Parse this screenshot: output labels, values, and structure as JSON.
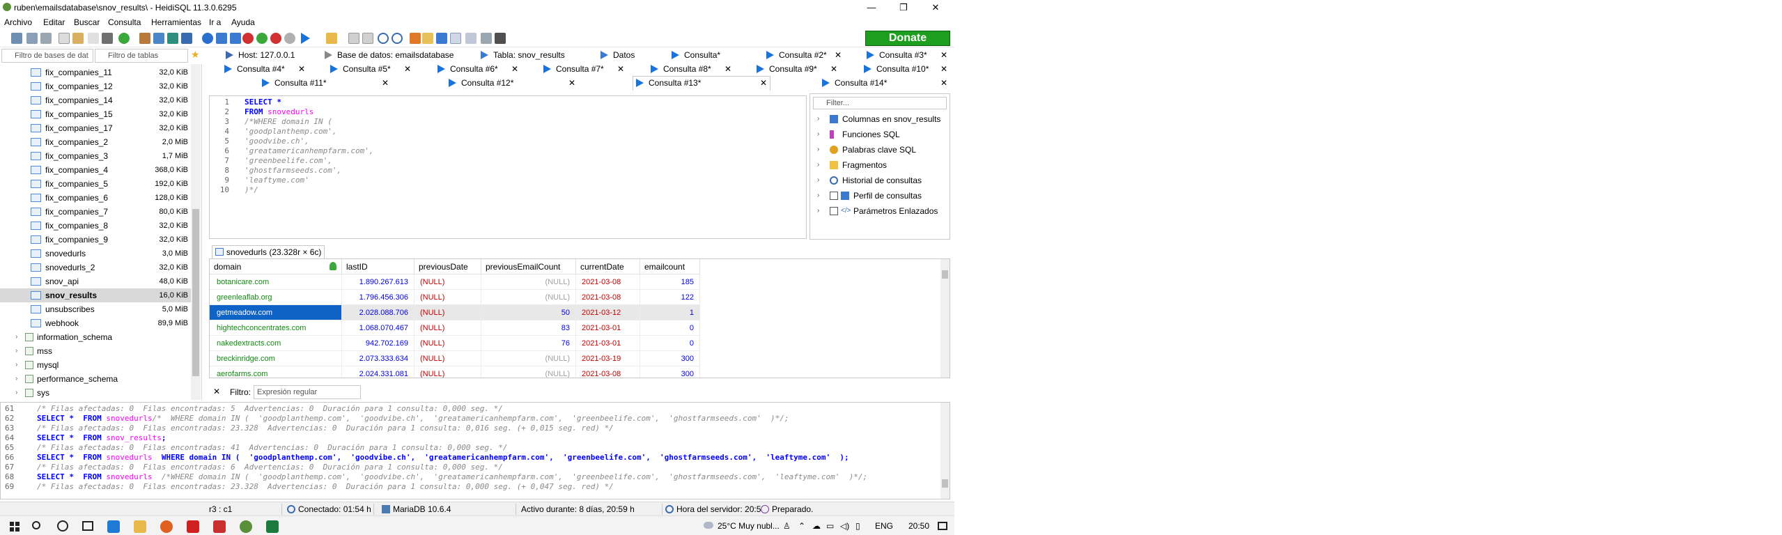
{
  "window": {
    "title": "ruben\\emailsdatabase\\snov_results\\ - HeidiSQL 11.3.0.6295",
    "controls": [
      "—",
      "❐",
      "✕"
    ]
  },
  "menu": [
    "Archivo",
    "Editar",
    "Buscar",
    "Consulta",
    "Herramientas",
    "Ir a",
    "Ayuda"
  ],
  "toolbar": {
    "donate_label": "Donate"
  },
  "filters": {
    "db_placeholder": "Filtro de bases de dat",
    "table_placeholder": "Filtro de tablas"
  },
  "tabs_row1": [
    {
      "label": "Host: 127.0.0.1"
    },
    {
      "label": "Base de datos: emailsdatabase"
    },
    {
      "label": "Tabla: snov_results"
    },
    {
      "label": "Datos"
    },
    {
      "label": "Consulta*"
    },
    {
      "label": "Consulta #2*"
    },
    {
      "label": "Consulta #3*"
    }
  ],
  "tabs_row2": [
    {
      "label": "Consulta #4*"
    },
    {
      "label": "Consulta #5*"
    },
    {
      "label": "Consulta #6*"
    },
    {
      "label": "Consulta #7*"
    },
    {
      "label": "Consulta #8*"
    },
    {
      "label": "Consulta #9*"
    },
    {
      "label": "Consulta #10*"
    }
  ],
  "tabs_row3": [
    {
      "label": "Consulta #11*"
    },
    {
      "label": "Consulta #12*"
    },
    {
      "label": "Consulta #13*"
    },
    {
      "label": "Consulta #14*"
    }
  ],
  "tree": {
    "tables": [
      {
        "name": "fix_companies_11",
        "size": "32,0 KiB"
      },
      {
        "name": "fix_companies_12",
        "size": "32,0 KiB"
      },
      {
        "name": "fix_companies_14",
        "size": "32,0 KiB"
      },
      {
        "name": "fix_companies_15",
        "size": "32,0 KiB"
      },
      {
        "name": "fix_companies_17",
        "size": "32,0 KiB"
      },
      {
        "name": "fix_companies_2",
        "size": "2,0 MiB"
      },
      {
        "name": "fix_companies_3",
        "size": "1,7 MiB"
      },
      {
        "name": "fix_companies_4",
        "size": "368,0 KiB"
      },
      {
        "name": "fix_companies_5",
        "size": "192,0 KiB"
      },
      {
        "name": "fix_companies_6",
        "size": "128,0 KiB"
      },
      {
        "name": "fix_companies_7",
        "size": "80,0 KiB"
      },
      {
        "name": "fix_companies_8",
        "size": "32,0 KiB"
      },
      {
        "name": "fix_companies_9",
        "size": "32,0 KiB"
      },
      {
        "name": "snovedurls",
        "size": "3,0 MiB"
      },
      {
        "name": "snovedurls_2",
        "size": "32,0 KiB"
      },
      {
        "name": "snov_api",
        "size": "48,0 KiB"
      },
      {
        "name": "snov_results",
        "size": "16,0 KiB"
      },
      {
        "name": "unsubscribes",
        "size": "5,0 MiB"
      },
      {
        "name": "webhook",
        "size": "89,9 MiB"
      }
    ],
    "databases": [
      "information_schema",
      "mss",
      "mysql",
      "performance_schema",
      "sys"
    ]
  },
  "editor": {
    "lines": [
      "1",
      "2",
      "3",
      "4",
      "5",
      "6",
      "7",
      "8",
      "9",
      "10"
    ],
    "l1_kw": "SELECT",
    "l1_rest": " *",
    "l2_kw": "FROM",
    "l2_tbl": " snovedurls",
    "l3": "/*WHERE domain IN (",
    "l4": "'goodplanthemp.com',",
    "l5": "'goodvibe.ch',",
    "l6": "'greatamericanhempfarm.com',",
    "l7": "'greenbeelife.com',",
    "l8": "'ghostfarmseeds.com',",
    "l9": "'leaftyme.com'",
    "l10": ")*/"
  },
  "helper": {
    "filter_placeholder": "Filter...",
    "items": [
      "Columnas en snov_results",
      "Funciones SQL",
      "Palabras clave SQL",
      "Fragmentos",
      "Historial de consultas",
      "Perfil de consultas",
      "Parámetros Enlazados"
    ]
  },
  "result_tab": "snovedurls (23.328r × 6c)",
  "grid": {
    "columns": [
      "domain",
      "lastID",
      "previousDate",
      "previousEmailCount",
      "currentDate",
      "emailcount"
    ],
    "rows": [
      [
        "botanicare.com",
        "1.890.267.613",
        "(NULL)",
        "(NULL)",
        "2021-03-08",
        "185"
      ],
      [
        "greenleaflab.org",
        "1.796.456.306",
        "(NULL)",
        "(NULL)",
        "2021-03-08",
        "122"
      ],
      [
        "getmeadow.com",
        "2.028.088.706",
        "(NULL)",
        "50",
        "2021-03-12",
        "1"
      ],
      [
        "hightechconcentrates.com",
        "1.068.070.467",
        "(NULL)",
        "83",
        "2021-03-01",
        "0"
      ],
      [
        "nakedextracts.com",
        "942.702.169",
        "(NULL)",
        "76",
        "2021-03-01",
        "0"
      ],
      [
        "breckinridge.com",
        "2.073.333.634",
        "(NULL)",
        "(NULL)",
        "2021-03-19",
        "300"
      ],
      [
        "aerofarms.com",
        "2.024.331.081",
        "(NULL)",
        "(NULL)",
        "2021-03-08",
        "300"
      ]
    ]
  },
  "filter_row": {
    "label": "Filtro:",
    "placeholder": "Expresión regular"
  },
  "log": {
    "lines": [
      "61",
      "62",
      "63",
      "64",
      "65",
      "66",
      "67",
      "68",
      "69"
    ],
    "l61": "/* Filas afectadas: 0  Filas encontradas: 5  Advertencias: 0  Duración para 1 consulta: 0,000 seg. */",
    "l62_a": "SELECT *  FROM ",
    "l62_b": "snovedurls",
    "l62_c": "/*  WHERE domain IN (  'goodplanthemp.com',  'goodvibe.ch',  'greatamericanhempfarm.com',  'greenbeelife.com',  'ghostfarmseeds.com'  )*/;",
    "l63": "/* Filas afectadas: 0  Filas encontradas: 23.328  Advertencias: 0  Duración para 1 consulta: 0,016 seg. (+ 0,015 seg. red) */",
    "l64_a": "SELECT *  FROM ",
    "l64_b": "snov_results",
    "l64_c": ";",
    "l65": "/* Filas afectadas: 0  Filas encontradas: 41  Advertencias: 0  Duración para 1 consulta: 0,000 seg. */",
    "l66_a": "SELECT *  FROM ",
    "l66_b": "snovedurls",
    "l66_c": "  WHERE domain IN (  'goodplanthemp.com',  'goodvibe.ch',  'greatamericanhempfarm.com',  'greenbeelife.com',  'ghostfarmseeds.com',  'leaftyme.com'  );",
    "l67": "/* Filas afectadas: 0  Filas encontradas: 6  Advertencias: 0  Duración para 1 consulta: 0,000 seg. */",
    "l68_a": "SELECT *  FROM ",
    "l68_b": "snovedurls",
    "l68_c": "  /*WHERE domain IN (  'goodplanthemp.com',  'goodvibe.ch',  'greatamericanhempfarm.com',  'greenbeelife.com',  'ghostfarmseeds.com',  'leaftyme.com'  )*/;",
    "l69": "/* Filas afectadas: 0  Filas encontradas: 23.328  Advertencias: 0  Duración para 1 consulta: 0,000 seg. (+ 0,047 seg. red) */"
  },
  "status": {
    "pos": "r3 : c1",
    "connected": "Conectado: 01:54 h",
    "server": "MariaDB 10.6.4",
    "active": "Activo durante: 8 días, 20:59 h",
    "server_time": "Hora del servidor: 20:5",
    "ready": "Preparado."
  },
  "taskbar": {
    "weather": "25°C  Muy nubl...",
    "lang": "ENG",
    "time": "20:50"
  }
}
